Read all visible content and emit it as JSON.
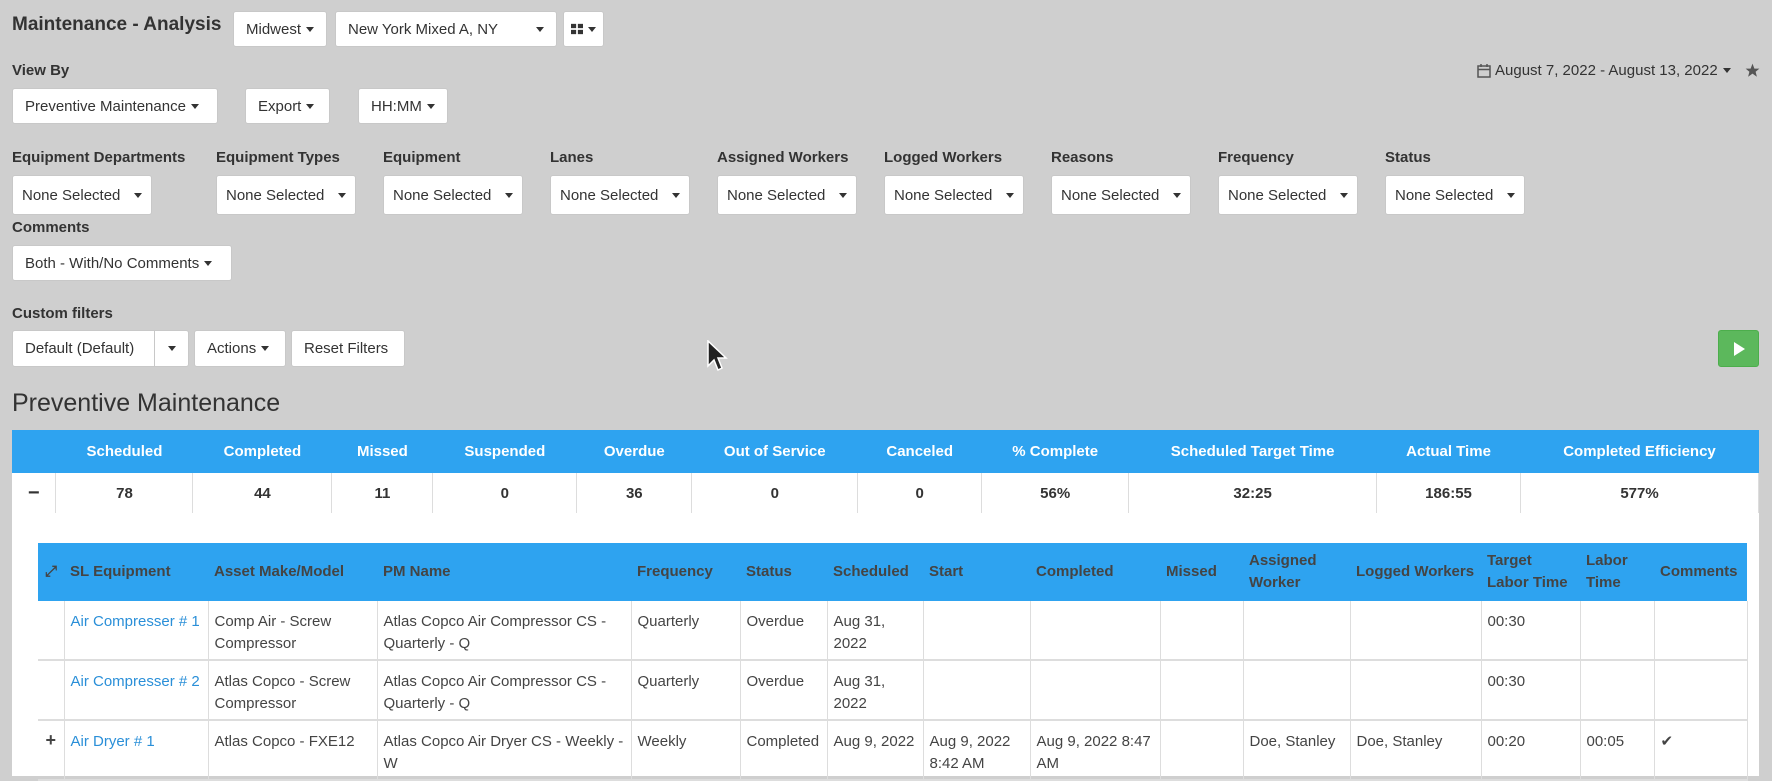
{
  "header": {
    "title": "Maintenance - Analysis",
    "region": "Midwest",
    "location": "New York Mixed A, NY",
    "date_range": "August 7, 2022 - August 13, 2022"
  },
  "view_by": {
    "label": "View By",
    "selected": "Preventive Maintenance",
    "export": "Export",
    "time_format": "HH:MM"
  },
  "filters": [
    {
      "label": "Equipment Departments",
      "value": "None Selected"
    },
    {
      "label": "Equipment Types",
      "value": "None Selected"
    },
    {
      "label": "Equipment",
      "value": "None Selected"
    },
    {
      "label": "Lanes",
      "value": "None Selected"
    },
    {
      "label": "Assigned Workers",
      "value": "None Selected"
    },
    {
      "label": "Logged Workers",
      "value": "None Selected"
    },
    {
      "label": "Reasons",
      "value": "None Selected"
    },
    {
      "label": "Frequency",
      "value": "None Selected"
    },
    {
      "label": "Status",
      "value": "None Selected"
    }
  ],
  "comments": {
    "label": "Comments",
    "value": "Both - With/No Comments"
  },
  "custom_filters": {
    "label": "Custom filters",
    "selected": "Default (Default)",
    "actions": "Actions",
    "reset": "Reset Filters"
  },
  "section_title": "Preventive Maintenance",
  "summary": {
    "collapse_symbol": "−",
    "headers": [
      "Scheduled",
      "Completed",
      "Missed",
      "Suspended",
      "Overdue",
      "Out of Service",
      "Canceled",
      "% Complete",
      "Scheduled Target Time",
      "Actual Time",
      "Completed Efficiency"
    ],
    "values": [
      "78",
      "44",
      "11",
      "0",
      "36",
      "0",
      "0",
      "56%",
      "32:25",
      "186:55",
      "577%"
    ]
  },
  "detail": {
    "expand_symbol": "⤢",
    "headers": [
      "SL Equipment",
      "Asset Make/Model",
      "PM Name",
      "Frequency",
      "Status",
      "Scheduled",
      "Start",
      "Completed",
      "Missed",
      "Assigned Worker",
      "Logged Workers",
      "Target Labor Time",
      "Labor Time",
      "Comments"
    ],
    "rows": [
      {
        "expand": "",
        "cells": [
          "Air Compresser # 1",
          "Comp Air - Screw Compressor",
          "Atlas Copco Air Compressor CS - Quarterly - Q",
          "Quarterly",
          "Overdue",
          "Aug 31, 2022",
          "",
          "",
          "",
          "",
          "",
          "00:30",
          "",
          ""
        ]
      },
      {
        "expand": "",
        "cells": [
          "Air Compresser # 2",
          "Atlas Copco - Screw Compressor",
          "Atlas Copco Air Compressor CS - Quarterly - Q",
          "Quarterly",
          "Overdue",
          "Aug 31, 2022",
          "",
          "",
          "",
          "",
          "",
          "00:30",
          "",
          ""
        ]
      },
      {
        "expand": "+",
        "cells": [
          "Air Dryer # 1",
          "Atlas Copco - FXE12",
          "Atlas Copco Air Dryer CS - Weekly - W",
          "Weekly",
          "Completed",
          "Aug 9, 2022",
          "Aug 9, 2022 8:42 AM",
          "Aug 9, 2022 8:47 AM",
          "",
          "Doe, Stanley",
          "Doe, Stanley",
          "00:20",
          "00:05",
          "✔"
        ]
      }
    ]
  },
  "colors": {
    "header_blue": "#2ea3f0",
    "link_blue": "#2a8fd8",
    "run_green": "#5cb85c",
    "background": "#cfcfcf"
  },
  "icons": {
    "grid": "grid-icon",
    "calendar": "calendar-icon",
    "star": "star-icon",
    "play": "play-icon",
    "cursor": "mouse-cursor-icon"
  }
}
